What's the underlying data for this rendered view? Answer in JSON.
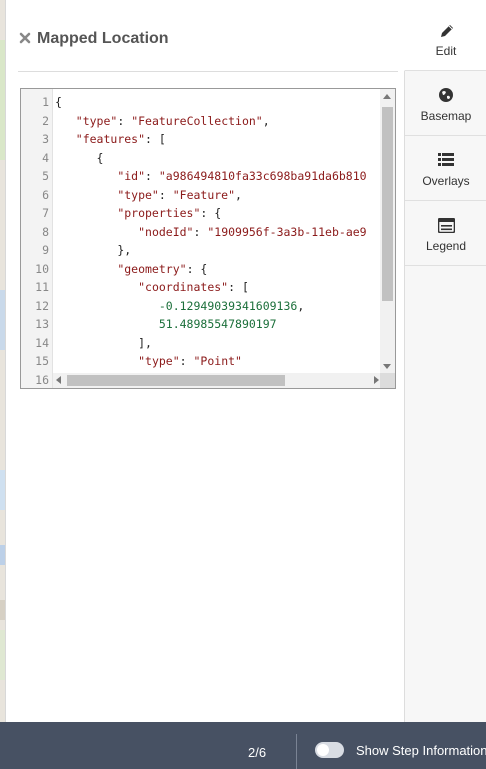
{
  "panel": {
    "title": "Mapped Location"
  },
  "editor": {
    "line_numbers": [
      "1",
      "2",
      "3",
      "4",
      "5",
      "6",
      "7",
      "8",
      "9",
      "10",
      "11",
      "12",
      "13",
      "14",
      "15",
      "16"
    ],
    "lines": [
      {
        "indent": "",
        "parts": [
          {
            "t": "{",
            "c": ""
          }
        ]
      },
      {
        "indent": "   ",
        "parts": [
          {
            "t": "\"type\"",
            "c": "k"
          },
          {
            "t": ": ",
            "c": ""
          },
          {
            "t": "\"FeatureCollection\"",
            "c": "s"
          },
          {
            "t": ",",
            "c": ""
          }
        ]
      },
      {
        "indent": "   ",
        "parts": [
          {
            "t": "\"features\"",
            "c": "k"
          },
          {
            "t": ": [",
            "c": ""
          }
        ]
      },
      {
        "indent": "      ",
        "parts": [
          {
            "t": "{",
            "c": ""
          }
        ]
      },
      {
        "indent": "         ",
        "parts": [
          {
            "t": "\"id\"",
            "c": "k"
          },
          {
            "t": ": ",
            "c": ""
          },
          {
            "t": "\"a986494810fa33c698ba91da6b810",
            "c": "s"
          }
        ]
      },
      {
        "indent": "         ",
        "parts": [
          {
            "t": "\"type\"",
            "c": "k"
          },
          {
            "t": ": ",
            "c": ""
          },
          {
            "t": "\"Feature\"",
            "c": "s"
          },
          {
            "t": ",",
            "c": ""
          }
        ]
      },
      {
        "indent": "         ",
        "parts": [
          {
            "t": "\"properties\"",
            "c": "k"
          },
          {
            "t": ": {",
            "c": ""
          }
        ]
      },
      {
        "indent": "            ",
        "parts": [
          {
            "t": "\"nodeId\"",
            "c": "k"
          },
          {
            "t": ": ",
            "c": ""
          },
          {
            "t": "\"1909956f-3a3b-11eb-ae9",
            "c": "s"
          }
        ]
      },
      {
        "indent": "         ",
        "parts": [
          {
            "t": "},",
            "c": ""
          }
        ]
      },
      {
        "indent": "         ",
        "parts": [
          {
            "t": "\"geometry\"",
            "c": "k"
          },
          {
            "t": ": {",
            "c": ""
          }
        ]
      },
      {
        "indent": "            ",
        "parts": [
          {
            "t": "\"coordinates\"",
            "c": "k"
          },
          {
            "t": ": [",
            "c": ""
          }
        ]
      },
      {
        "indent": "               ",
        "parts": [
          {
            "t": "-0.12949039341609136",
            "c": "n"
          },
          {
            "t": ",",
            "c": ""
          }
        ]
      },
      {
        "indent": "               ",
        "parts": [
          {
            "t": "51.48985547890197",
            "c": "n"
          }
        ]
      },
      {
        "indent": "            ",
        "parts": [
          {
            "t": "],",
            "c": ""
          }
        ]
      },
      {
        "indent": "            ",
        "parts": [
          {
            "t": "\"type\"",
            "c": "k"
          },
          {
            "t": ": ",
            "c": ""
          },
          {
            "t": "\"Point\"",
            "c": "s"
          }
        ]
      }
    ]
  },
  "sidebar": {
    "tabs": [
      {
        "label": "Edit",
        "icon": "pencil-icon",
        "active": true
      },
      {
        "label": "Basemap",
        "icon": "globe-icon",
        "active": false
      },
      {
        "label": "Overlays",
        "icon": "list-icon",
        "active": false
      },
      {
        "label": "Legend",
        "icon": "legend-icon",
        "active": false
      }
    ]
  },
  "footer": {
    "step_count": "2/6",
    "toggle_label": "Show Step Information",
    "toggle_on": false
  }
}
